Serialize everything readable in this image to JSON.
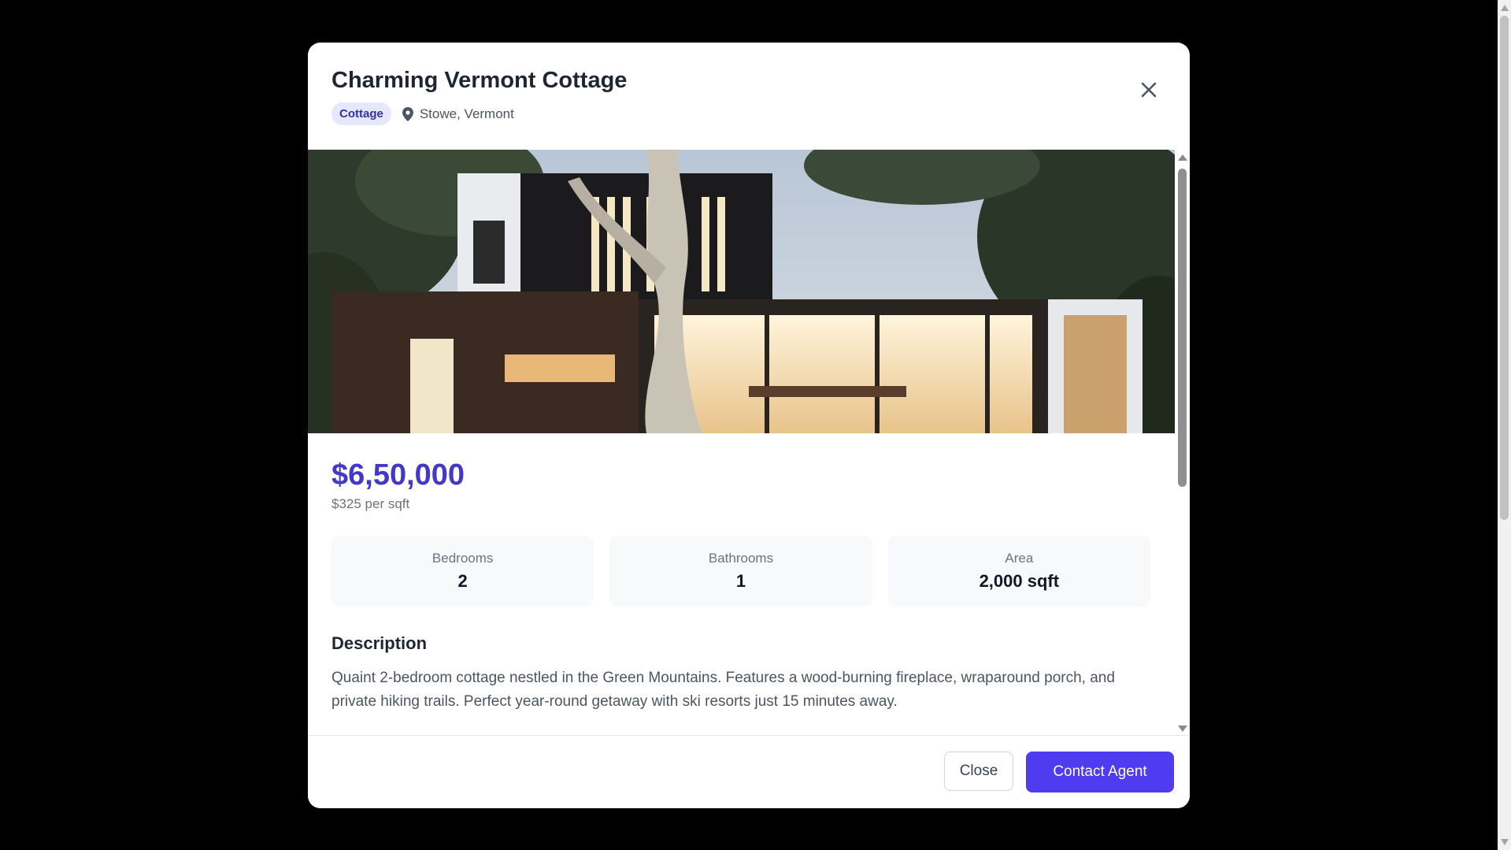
{
  "modal": {
    "title": "Charming Vermont Cottage",
    "type_badge": "Cottage",
    "location": "Stowe, Vermont",
    "price": "$6,50,000",
    "price_per_sqft": "$325 per sqft",
    "stats": [
      {
        "label": "Bedrooms",
        "value": "2"
      },
      {
        "label": "Bathrooms",
        "value": "1"
      },
      {
        "label": "Area",
        "value": "2,000 sqft"
      }
    ],
    "description_title": "Description",
    "description": "Quaint 2-bedroom cottage nestled in the Green Mountains. Features a wood-burning fireplace, wraparound porch, and private hiking trails. Perfect year-round getaway with ski resorts just 15 minutes away.",
    "footer": {
      "close_label": "Close",
      "contact_label": "Contact Agent"
    }
  },
  "colors": {
    "accent": "#4f3bf0",
    "price": "#4338ca",
    "badge_bg": "#e5e7ff",
    "badge_text": "#3730a3",
    "backdrop": "#000000"
  },
  "icons": {
    "close": "close-icon",
    "location": "map-pin-icon"
  }
}
